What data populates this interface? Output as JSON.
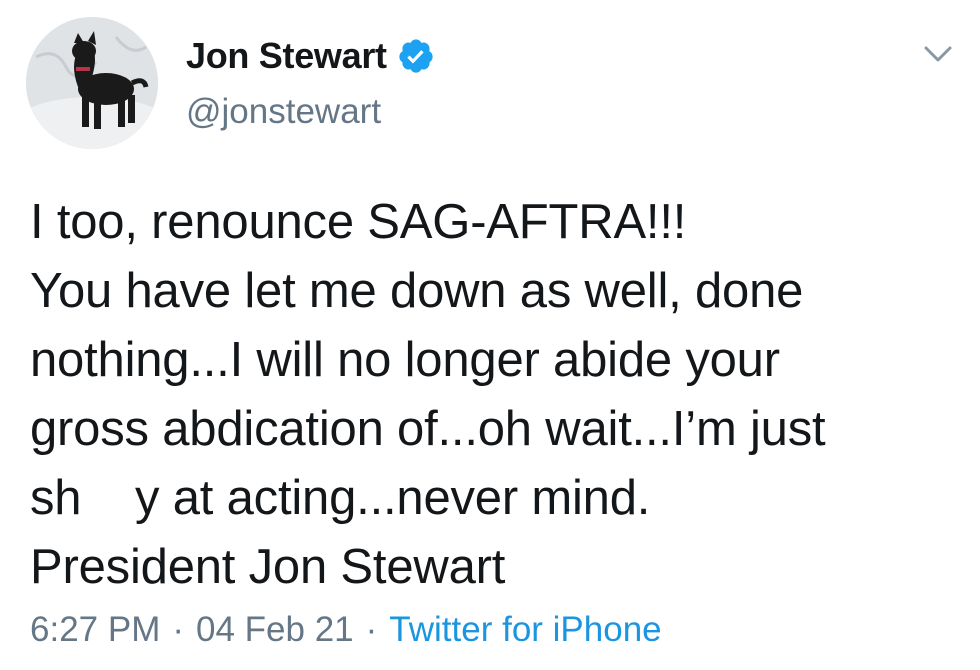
{
  "author": {
    "display_name": "Jon Stewart",
    "handle": "@jonstewart",
    "verified": true,
    "avatar_icon": "dog-avatar-image"
  },
  "tweet": {
    "lines": [
      "I too, renounce SAG-AFTRA!!!",
      "You have let me down as well, done",
      "nothing...I will no longer abide your",
      "gross abdication of...oh wait...I’m just",
      "sh    y at acting...never mind.",
      "President Jon Stewart"
    ]
  },
  "meta": {
    "time": "6:27 PM",
    "separator": "·",
    "date": "04 Feb 21",
    "source": "Twitter for iPhone"
  },
  "colors": {
    "text": "#14171a",
    "secondary": "#657786",
    "link": "#1b95e0",
    "verified_badge": "#1da1f2"
  },
  "icons": {
    "verified": "verified-badge-icon",
    "menu": "chevron-down-icon"
  }
}
